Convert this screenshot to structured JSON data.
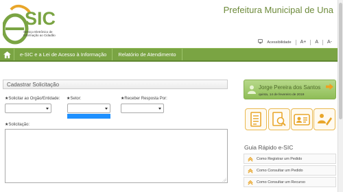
{
  "header": {
    "logo_text": "e-SIC",
    "logo_tagline": [
      "Serviço Eletrônico de",
      "Informação ao Cidadão"
    ],
    "municipality": "Prefeitura Municipal de Una",
    "accessibility_label": "Acessibilidade",
    "font_increase": "A+",
    "font_reset": "A",
    "font_decrease": "A-"
  },
  "nav": {
    "items": [
      {
        "label": "e-SIC e a Lei de Acesso à Informação"
      },
      {
        "label": "Relatório de Atendimento"
      }
    ]
  },
  "form": {
    "title": "Cadastrar Solicitação",
    "fields": {
      "orgao": "Solicitar ao Orgão/Entidade:",
      "setor": "Setor:",
      "resposta": "Receber Resposta Por:",
      "solicitacao": "Solicitação:"
    }
  },
  "user": {
    "name": "Jorge Pereira dos Santos",
    "date": "quinta, 14 de fevereiro de 2019"
  },
  "quick": {
    "title": "Guia Rápido e-SIC",
    "items": [
      {
        "label": "Como Registrar um Pedido"
      },
      {
        "label": "Como Consultar um Pedido"
      },
      {
        "label": "Como Consultar um Recurso"
      }
    ]
  },
  "colors": {
    "brand_green": "#7aa443",
    "brand_orange": "#e9a62a",
    "selection_blue": "#1e90ff"
  },
  "icons": {
    "home": "home-icon",
    "accessibility": "accessibility-icon",
    "user": "user-icon",
    "logout": "logout-arrow-icon",
    "shortcut_1": "document-icon",
    "shortcut_2": "search-document-icon",
    "shortcut_3": "id-card-icon",
    "shortcut_4": "pen-signature-icon",
    "quick_item": "chevron-up-icon"
  }
}
